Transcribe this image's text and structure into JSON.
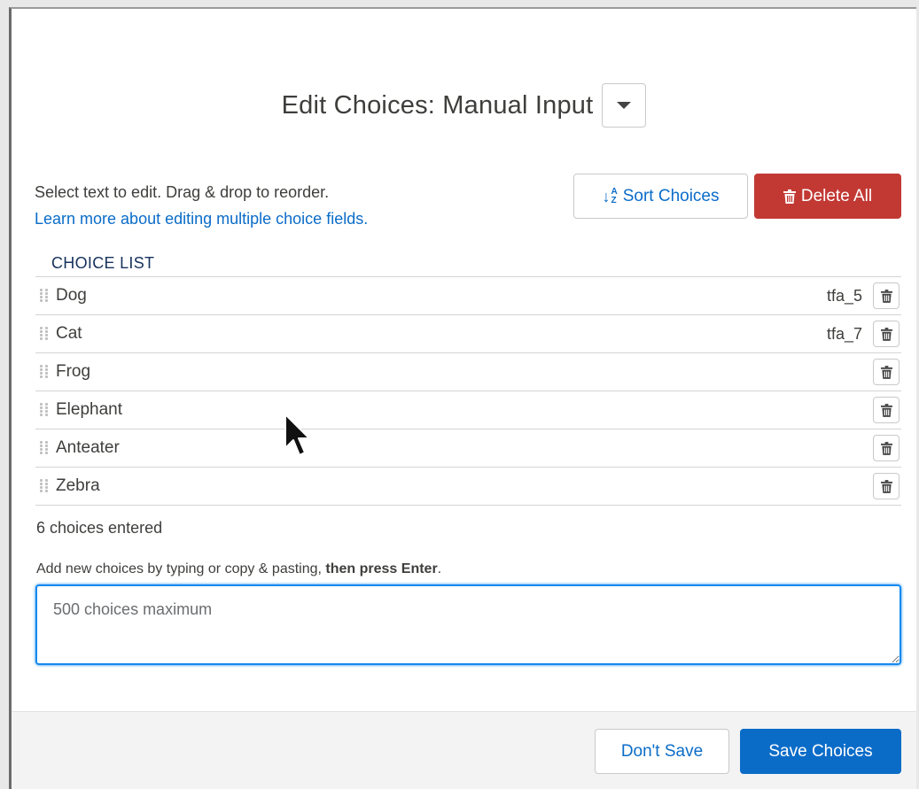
{
  "header": {
    "title": "Edit Choices: Manual Input"
  },
  "instructions": {
    "text": "Select text to edit. Drag & drop to reorder.",
    "link": "Learn more about editing multiple choice fields."
  },
  "toolbar": {
    "sort_label": "Sort Choices",
    "delete_all_label": "Delete All"
  },
  "list": {
    "header": "CHOICE LIST",
    "items": [
      {
        "label": "Dog",
        "alias": "tfa_5"
      },
      {
        "label": "Cat",
        "alias": "tfa_7"
      },
      {
        "label": "Frog",
        "alias": ""
      },
      {
        "label": "Elephant",
        "alias": ""
      },
      {
        "label": "Anteater",
        "alias": ""
      },
      {
        "label": "Zebra",
        "alias": ""
      }
    ],
    "count_text": "6 choices entered"
  },
  "add": {
    "hint_text": "Add new choices by typing or copy & pasting, ",
    "hint_bold": "then press Enter",
    "hint_end": ".",
    "placeholder": "500 choices maximum"
  },
  "footer": {
    "dont_save_label": "Don't Save",
    "save_label": "Save Choices"
  },
  "colors": {
    "link": "#0b6cc8",
    "danger": "#c23934",
    "focus": "#1589ee"
  },
  "icons": {
    "title_dropdown": "chevron-down-icon",
    "sort": "sort-icon",
    "delete": "trash-icon",
    "drag": "drag-handle-icon"
  }
}
